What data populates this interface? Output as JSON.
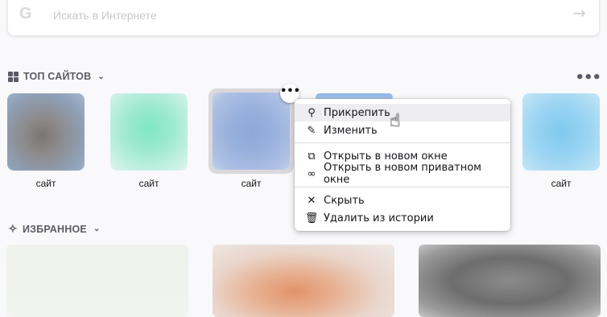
{
  "search": {
    "placeholder": "Искать в Интернете",
    "engine_icon": "google-g",
    "go_icon": "arrow-right"
  },
  "top_sites": {
    "title": "ТОП САЙТОВ",
    "tiles": [
      {
        "label": "сайт"
      },
      {
        "label": "сайт"
      },
      {
        "label": "сайт"
      },
      {
        "label": ""
      },
      {
        "label": "сайт"
      }
    ]
  },
  "context_menu": {
    "items": [
      {
        "label": "Прикрепить",
        "icon": "pin-icon"
      },
      {
        "label": "Изменить",
        "icon": "pencil-icon"
      },
      {
        "label": "Открыть в новом окне",
        "icon": "open-new-window-icon"
      },
      {
        "label": "Открыть в новом приватном окне",
        "icon": "private-mask-icon"
      },
      {
        "label": "Скрыть",
        "icon": "close-icon"
      },
      {
        "label": "Удалить из истории",
        "icon": "trash-icon"
      }
    ]
  },
  "highlights": {
    "title": "ИЗБРАННОЕ"
  }
}
